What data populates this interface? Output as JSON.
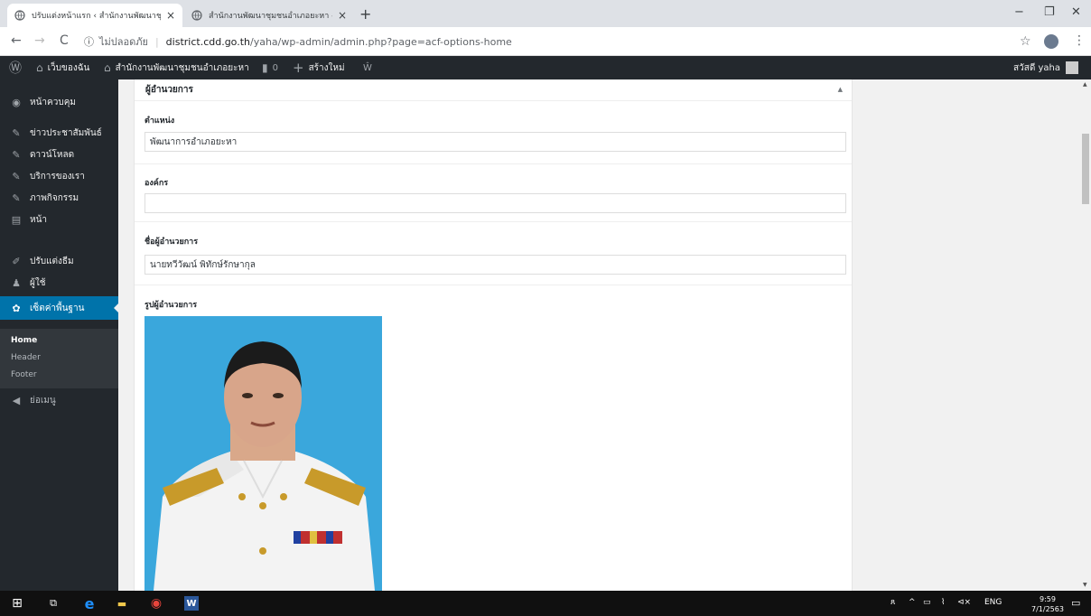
{
  "browser": {
    "tabs": [
      {
        "title": "ปรับแต่งหน้าแรก ‹ สำนักงานพัฒนาชุมชน",
        "active": true,
        "close": "×"
      },
      {
        "title": "สำนักงานพัฒนาชุมชนอำเภอยะหา - ",
        "active": false,
        "close": "×"
      }
    ],
    "new_tab": "+",
    "controls": {
      "minimize": "−",
      "maximize": "❐",
      "close": "✕"
    },
    "nav": {
      "back": "←",
      "forward": "→",
      "reload": "C"
    },
    "address": {
      "info_icon": "ⓘ",
      "security": "ไม่ปลอดภัย",
      "separator": "|",
      "host": "district.cdd.go.th",
      "path": "/yaha/wp-admin/admin.php?page=acf-options-home"
    },
    "bookmark_icon": "☆",
    "menu_icon": "⋮"
  },
  "adminbar": {
    "wp_logo": "Ⓦ",
    "my_sites_icon": "⌂",
    "my_sites": "เว็บของฉัน",
    "site_icon": "⌂",
    "site_name": "สำนักงานพัฒนาชุมชนอำเภอยะหา",
    "comments_icon": "▮",
    "comments_count": "0",
    "new_icon": "+",
    "new_label": "สร้างใหม่",
    "extra_icon": "Ŵ",
    "greeting": "สวัสดี yaha"
  },
  "sidebar": {
    "items": [
      {
        "icon": "◉",
        "label": "หน้าควบคุม"
      },
      {
        "icon": "✎",
        "label": "ข่าวประชาสัมพันธ์"
      },
      {
        "icon": "✎",
        "label": "ดาวน์โหลด"
      },
      {
        "icon": "✎",
        "label": "บริการของเรา"
      },
      {
        "icon": "✎",
        "label": "ภาพกิจกรรม"
      },
      {
        "icon": "▤",
        "label": "หน้า"
      },
      {
        "icon": "✐",
        "label": "ปรับแต่งธีม"
      },
      {
        "icon": "♟",
        "label": "ผู้ใช้"
      },
      {
        "icon": "✿",
        "label": "เซ็ตค่าพื้นฐาน"
      }
    ],
    "submenu": [
      "Home",
      "Header",
      "Footer"
    ],
    "collapse": {
      "icon": "◀",
      "label": "ย่อเมนู"
    }
  },
  "main": {
    "postbox_title": "ผู้อำนวยการ",
    "toggle": "▲",
    "fields": [
      {
        "label": "ตำแหน่ง",
        "value": "พัฒนาการอำเภอยะหา"
      },
      {
        "label": "องค์กร",
        "value": ""
      },
      {
        "label": "ชื่อผู้อำนวยการ",
        "value": "นายทวีวัฒน์ พิทักษ์รักษากุล"
      }
    ],
    "photo_label": "รูปผู้อำนวยการ"
  },
  "scrollbar": {
    "up": "▲",
    "down": "▼"
  },
  "taskbar": {
    "start_icon": "⊞",
    "taskview_icon": "⧉",
    "edge_icon": "e",
    "explorer_icon": "▬",
    "chrome_icon": "◉",
    "word_icon": "W",
    "tray_person": "ጸ",
    "tray_chevron": "^",
    "tray_battery": "▭",
    "tray_wifi": "⌇",
    "tray_volume": "⊲×",
    "lang": "ENG",
    "time": "9:59",
    "date": "7/1/2563",
    "notifications_icon": "▭"
  }
}
